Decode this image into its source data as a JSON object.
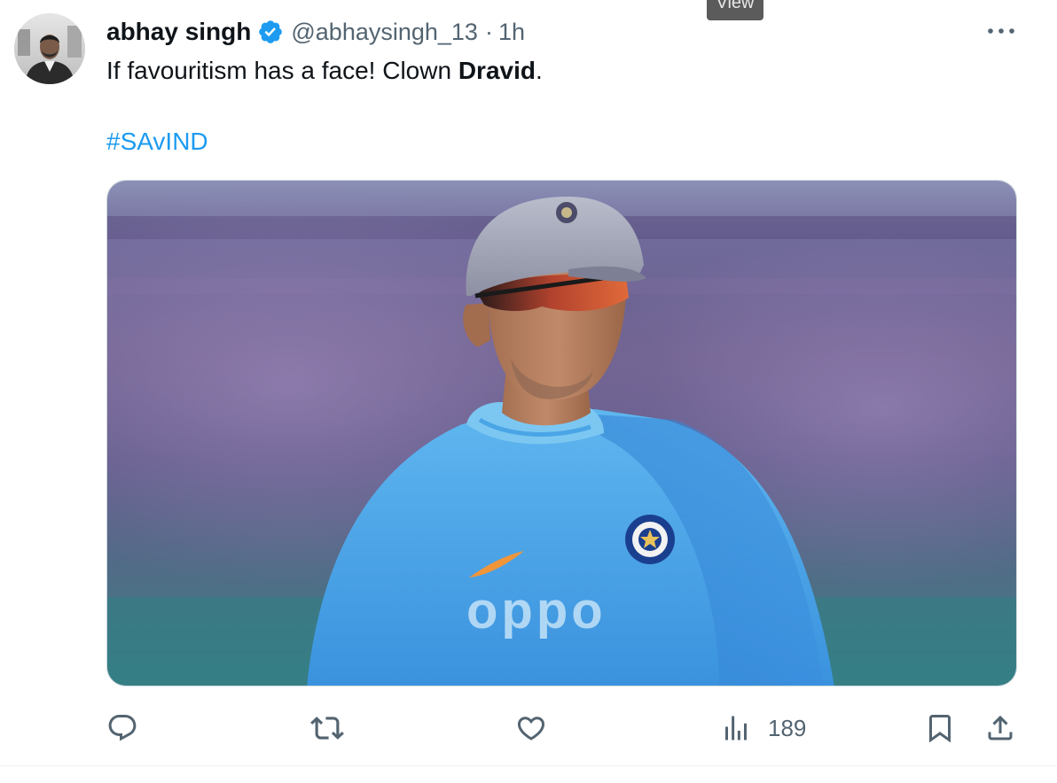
{
  "overlay": {
    "view_label": "View"
  },
  "tweet": {
    "author": {
      "display_name": "abhay singh",
      "handle": "@abhaysingh_13",
      "separator": "·",
      "time": "1h",
      "verified_icon": "verified-badge-icon"
    },
    "text": {
      "prefix": "If favouritism has a face! Clown ",
      "bold": "Dravid",
      "suffix": "."
    },
    "hashtag": "#SAvIND",
    "media": {
      "subject": "photo of a cricket coach in a light blue India training shirt, grey cap and sunglasses",
      "shirt_text": "oppo"
    },
    "actions": {
      "reply_icon": "reply-icon",
      "retweet_icon": "retweet-icon",
      "like_icon": "heart-icon",
      "views_icon": "views-chart-icon",
      "views_count": "189",
      "bookmark_icon": "bookmark-icon",
      "share_icon": "share-icon"
    },
    "more_icon": "more-options-icon"
  },
  "colors": {
    "accent": "#1d9bf0",
    "muted": "#536471",
    "text": "#0f1419"
  }
}
